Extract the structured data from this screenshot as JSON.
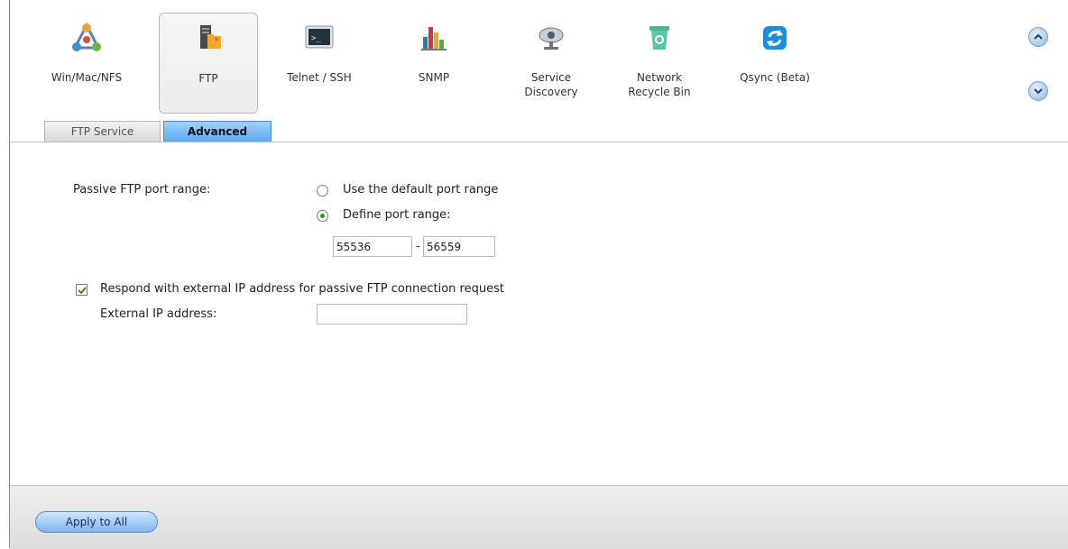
{
  "toolbar": {
    "items": [
      {
        "label": "Win/Mac/NFS",
        "icon": "network-share-icon"
      },
      {
        "label": "FTP",
        "icon": "ftp-folder-icon"
      },
      {
        "label": "Telnet / SSH",
        "icon": "terminal-icon"
      },
      {
        "label": "SNMP",
        "icon": "bar-chart-icon"
      },
      {
        "label": "Service\nDiscovery",
        "icon": "satellite-dish-icon"
      },
      {
        "label": "Network\nRecycle Bin",
        "icon": "recycle-bin-icon"
      },
      {
        "label": "Qsync (Beta)",
        "icon": "sync-icon"
      }
    ],
    "selected": "FTP"
  },
  "tabs": [
    "FTP Service",
    "Advanced"
  ],
  "active_tab": "Advanced",
  "form": {
    "passive_label": "Passive FTP port range:",
    "option_default": "Use the default port range",
    "option_define": "Define port range:",
    "selected_option": "Define port range:",
    "port_from": "55536",
    "port_separator": "-",
    "port_to": "56559",
    "respond_label": "Respond with external IP address for passive FTP connection request",
    "respond_checked": true,
    "external_ip_label": "External IP address:",
    "external_ip_value": ""
  },
  "footer": {
    "apply_label": "Apply to All"
  },
  "colors": {
    "accent": "#5fa8ee",
    "check": "#3c8d2f"
  }
}
